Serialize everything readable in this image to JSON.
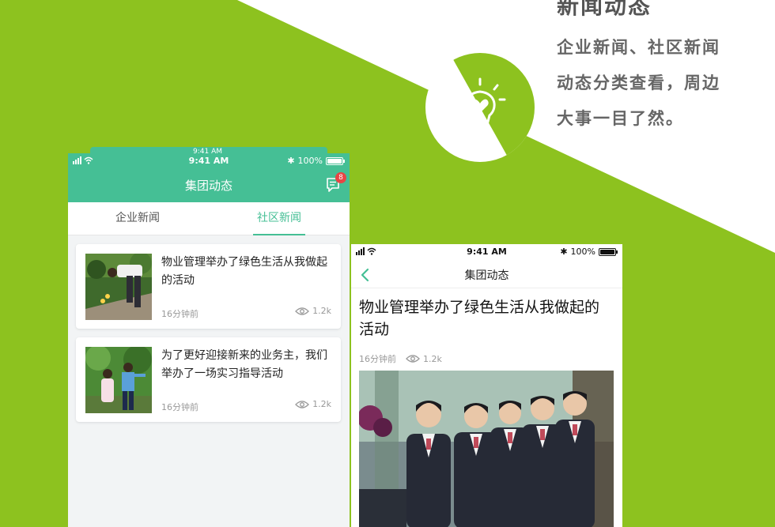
{
  "section": {
    "title": "新闻动态",
    "desc_lines": [
      "企业新闻、社区新闻",
      "动态分类查看，周边",
      "大事一目了然。"
    ]
  },
  "colors": {
    "green": "#8dc21f",
    "teal": "#45bf95",
    "badge": "#e84545"
  },
  "phone1": {
    "back_status": {
      "time": "9:41 AM",
      "battery": "100%"
    },
    "status": {
      "time": "9:41 AM",
      "battery": "100%"
    },
    "title": "集团动态",
    "message_badge": "8",
    "tabs": [
      {
        "label": "企业新闻",
        "active": false
      },
      {
        "label": "社区新闻",
        "active": true
      }
    ],
    "items": [
      {
        "title": "物业管理举办了绿色生活从我做起的活动",
        "time": "16分钟前",
        "views": "1.2k"
      },
      {
        "title": "为了更好迎接新来的业务主，我们举办了一场实习指导活动",
        "time": "16分钟前",
        "views": "1.2k"
      }
    ]
  },
  "phone2": {
    "status": {
      "time": "9:41 AM",
      "battery": "100%"
    },
    "title": "集团动态",
    "article": {
      "title": "物业管理举办了绿色生活从我做起的活动",
      "time": "16分钟前",
      "views": "1.2k"
    }
  },
  "icons": {
    "badge": "lightbulb-heart-icon",
    "message": "message-icon",
    "eye": "eye-icon",
    "back": "chevron-left-icon",
    "signal": "signal-icon",
    "wifi": "wifi-icon",
    "bluetooth": "bluetooth-icon",
    "battery": "battery-icon"
  }
}
